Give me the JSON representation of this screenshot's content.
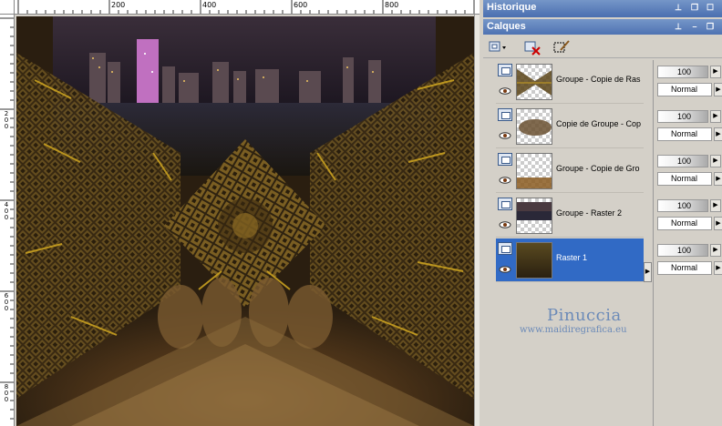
{
  "ruler": {
    "top_labels": [
      "200",
      "400",
      "600",
      "800"
    ],
    "left_labels": [
      "2\n0\n0",
      "4\n0\n0",
      "6\n0\n0",
      "8\n0\n0"
    ]
  },
  "panels": {
    "history_title": "Historique",
    "layers_title": "Calques"
  },
  "layers": [
    {
      "name": "Groupe - Copie de Ras",
      "opacity": "100",
      "blend": "Normal",
      "selected": false
    },
    {
      "name": "Copie de Groupe - Cop",
      "opacity": "100",
      "blend": "Normal",
      "selected": false
    },
    {
      "name": "Groupe - Copie de Gro",
      "opacity": "100",
      "blend": "Normal",
      "selected": false
    },
    {
      "name": "Groupe - Raster 2",
      "opacity": "100",
      "blend": "Normal",
      "selected": false
    },
    {
      "name": "Raster 1",
      "opacity": "100",
      "blend": "Normal",
      "selected": true
    }
  ],
  "watermark": {
    "name": "Pinuccia",
    "url": "www.maidiregrafica.eu"
  },
  "colors": {
    "title_bar": "#4a6fb0",
    "selected_row": "#316ac5",
    "gold": "#c8a020"
  }
}
